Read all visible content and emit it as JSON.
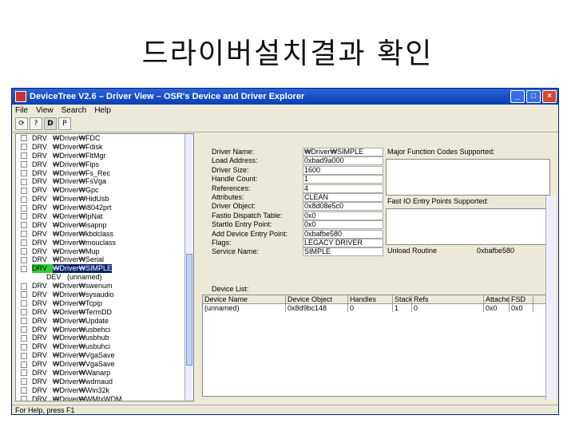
{
  "slide": {
    "title": "드라이버설치결과 확인"
  },
  "window": {
    "title": "DeviceTree V2.6 – Driver View – OSR's Device and Driver Explorer",
    "controls": {
      "minimize": "_",
      "maximize": "□",
      "close": "×"
    }
  },
  "menu": [
    "File",
    "View",
    "Search",
    "Help"
  ],
  "toolbar": {
    "d_label": "D",
    "p_label": "P"
  },
  "tree": [
    {
      "type": "DRV",
      "name": "₩Driver₩FDC",
      "child": false,
      "selected": false
    },
    {
      "type": "DRV",
      "name": "₩Driver₩Fdisk",
      "child": false,
      "selected": false
    },
    {
      "type": "DRV",
      "name": "₩Driver₩FltMgr",
      "child": false,
      "selected": false
    },
    {
      "type": "DRV",
      "name": "₩Driver₩Fips",
      "child": false,
      "selected": false
    },
    {
      "type": "DRV",
      "name": "₩Driver₩Fs_Rec",
      "child": false,
      "selected": false
    },
    {
      "type": "DRV",
      "name": "₩Driver₩FsVga",
      "child": false,
      "selected": false
    },
    {
      "type": "DRV",
      "name": "₩Driver₩Gpc",
      "child": false,
      "selected": false
    },
    {
      "type": "DRV",
      "name": "₩Driver₩HidUsb",
      "child": false,
      "selected": false
    },
    {
      "type": "DRV",
      "name": "₩Driver₩i8042prt",
      "child": false,
      "selected": false
    },
    {
      "type": "DRV",
      "name": "₩Driver₩IpNat",
      "child": false,
      "selected": false
    },
    {
      "type": "DRV",
      "name": "₩Driver₩isapnp",
      "child": false,
      "selected": false
    },
    {
      "type": "DRV",
      "name": "₩Driver₩kbdclass",
      "child": false,
      "selected": false
    },
    {
      "type": "DRV",
      "name": "₩Driver₩mouclass",
      "child": false,
      "selected": false
    },
    {
      "type": "DRV",
      "name": "₩Driver₩Mup",
      "child": false,
      "selected": false
    },
    {
      "type": "DRV",
      "name": "₩Driver₩Serial",
      "child": false,
      "selected": false
    },
    {
      "type": "DRV",
      "name": "₩Driver₩SIMPLE",
      "child": false,
      "selected": true
    },
    {
      "type": "DEV",
      "name": "(unnamed)",
      "child": true,
      "selected": false
    },
    {
      "type": "DRV",
      "name": "₩Driver₩swenum",
      "child": false,
      "selected": false
    },
    {
      "type": "DRV",
      "name": "₩Driver₩sysaudio",
      "child": false,
      "selected": false
    },
    {
      "type": "DRV",
      "name": "₩Driver₩Tcpip",
      "child": false,
      "selected": false
    },
    {
      "type": "DRV",
      "name": "₩Driver₩TermDD",
      "child": false,
      "selected": false
    },
    {
      "type": "DRV",
      "name": "₩Driver₩Update",
      "child": false,
      "selected": false
    },
    {
      "type": "DRV",
      "name": "₩Driver₩usbehci",
      "child": false,
      "selected": false
    },
    {
      "type": "DRV",
      "name": "₩Driver₩usbhub",
      "child": false,
      "selected": false
    },
    {
      "type": "DRV",
      "name": "₩Driver₩usbuhci",
      "child": false,
      "selected": false
    },
    {
      "type": "DRV",
      "name": "₩Driver₩VgaSave",
      "child": false,
      "selected": false
    },
    {
      "type": "DRV",
      "name": "₩Driver₩VgaSave",
      "child": false,
      "selected": false
    },
    {
      "type": "DRV",
      "name": "₩Driver₩Wanarp",
      "child": false,
      "selected": false
    },
    {
      "type": "DRV",
      "name": "₩Driver₩wdmaud",
      "child": false,
      "selected": false
    },
    {
      "type": "DRV",
      "name": "₩Driver₩Win32k",
      "child": false,
      "selected": false
    },
    {
      "type": "DRV",
      "name": "₩Driver₩WMIxWDM",
      "child": false,
      "selected": false
    }
  ],
  "details": {
    "fields": [
      {
        "label": "Driver Name:",
        "value": "₩Driver₩SIMPLE"
      },
      {
        "label": "Load Address:",
        "value": "0xbad9a000"
      },
      {
        "label": "Driver Size:",
        "value": "1600"
      },
      {
        "label": "Handle Count:",
        "value": "1"
      },
      {
        "label": "References:",
        "value": "4"
      },
      {
        "label": "Attributes:",
        "value": "CLEAN"
      },
      {
        "label": "Driver Object:",
        "value": "0x8d08e5c0"
      },
      {
        "label": "Fastio Dispatch Table:",
        "value": "0x0"
      },
      {
        "label": "StartIo Entry Point:",
        "value": "0x0"
      },
      {
        "label": "Add Device Entry Point:",
        "value": "0xbafbe580"
      },
      {
        "label": "Flags:",
        "value": "LEGACY DRIVER"
      },
      {
        "label": "Service Name:",
        "value": "SIMPLE"
      }
    ],
    "major_function_label": "Major Function Codes Supported:",
    "fast_io_label": "Fast IO Entry Points Supported:",
    "unload_label": "Unload Routine",
    "unload_value": "0xbafbe580",
    "device_list_label": "Device List:"
  },
  "device_table": {
    "headers": [
      "Device Name",
      "Device Object",
      "Handles",
      "Stack",
      "Refs",
      "Attached",
      "FSD"
    ],
    "rows": [
      [
        "(unnamed)",
        "0x8d9bc148",
        "0",
        "1",
        "0",
        "0x0",
        "0x0"
      ]
    ]
  },
  "statusbar": {
    "text": "For Help, press F1"
  }
}
